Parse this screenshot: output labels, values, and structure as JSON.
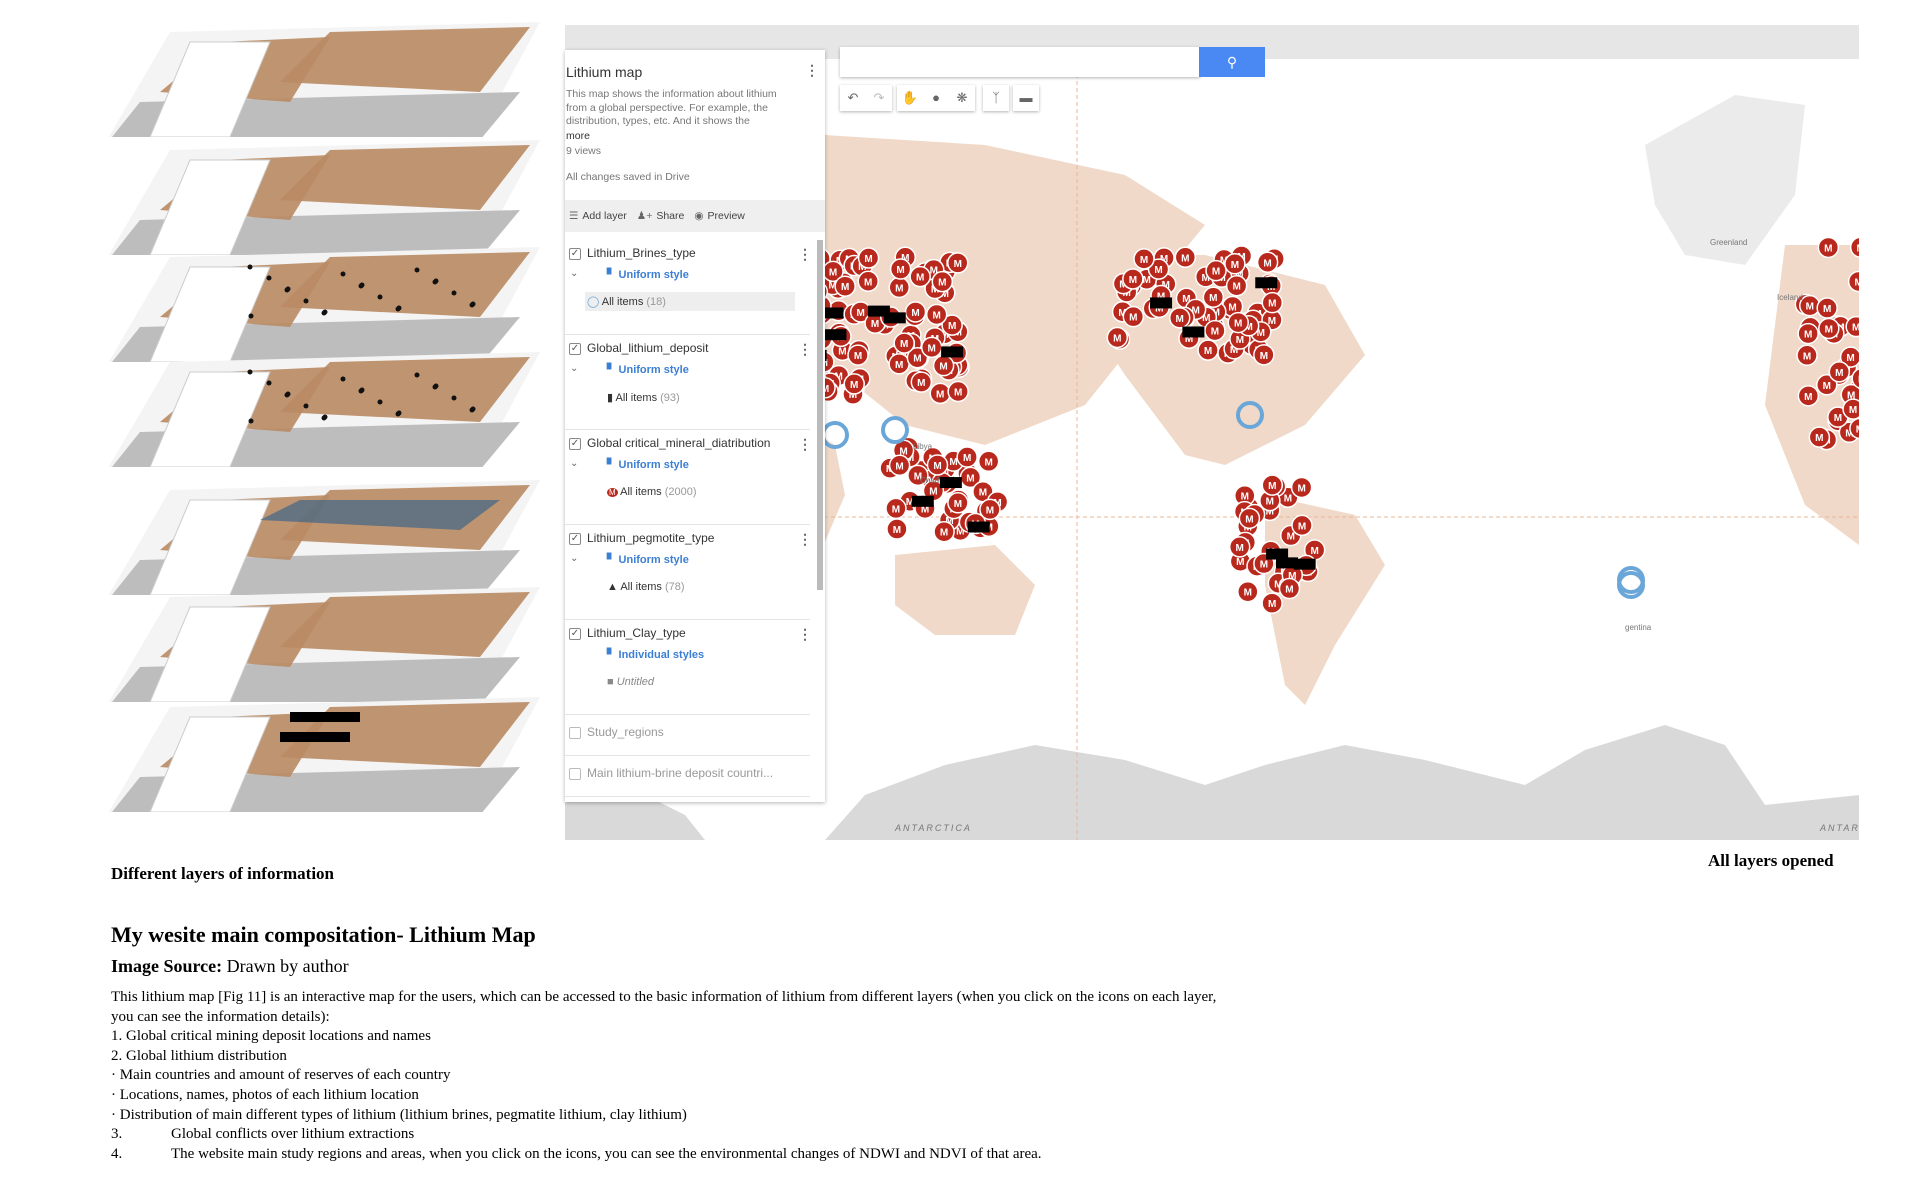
{
  "figure": {
    "left_caption": "Different layers of information",
    "right_caption": "All layers opened"
  },
  "map": {
    "title": "Lithium map",
    "description": "This map shows the information about lithium from a global perspective. For example, the distribution, types, etc. And it shows the",
    "more_label": "more",
    "views": "9 views",
    "saved_status": "All changes saved in Drive",
    "actions": {
      "add_layer": "Add layer",
      "share": "Share",
      "preview": "Preview"
    },
    "layers": [
      {
        "name": "Lithium_Brines_type",
        "checked": true,
        "style": "Uniform style",
        "items_label": "All items",
        "count": "(18)",
        "icon": "water-drop-icon"
      },
      {
        "name": "Global_lithium_deposit",
        "checked": true,
        "style": "Uniform style",
        "items_label": "All items",
        "count": "(93)",
        "icon": "battery-icon"
      },
      {
        "name": "Global critical_mineral_diatribution",
        "checked": true,
        "style": "Uniform style",
        "items_label": "All items",
        "count": "(2000)",
        "icon": "m-marker-icon"
      },
      {
        "name": "Lithium_pegmotite_type",
        "checked": true,
        "style": "Uniform style",
        "items_label": "All items",
        "count": "(78)",
        "icon": "mountain-icon"
      },
      {
        "name": "Lithium_Clay_type",
        "checked": true,
        "style": "Individual styles",
        "items_label": "Untitled",
        "count": "",
        "icon": "mine-cart-icon"
      },
      {
        "name": "Study_regions",
        "checked": false
      },
      {
        "name": "Main lithium-brine deposit countri...",
        "checked": false
      }
    ],
    "search": {
      "value": "",
      "placeholder": ""
    },
    "labels": {
      "antarctica": "ANTARCTICA",
      "antarctica2": "ANTARC",
      "greenland": "Greenland",
      "libya": "Libya",
      "chad": "Chad",
      "iceland": "Iceland",
      "argentina": "gentina"
    },
    "colors": {
      "marker": "#b8281c",
      "land": "#f0d9c8",
      "ice": "#d9d9d9",
      "accent": "#4a89f3",
      "brine": "#6aa7d8"
    }
  },
  "text": {
    "heading": "My wesite main compositation- Lithium Map",
    "source_label": "Image Source:",
    "source_value": " Drawn by author",
    "lines": [
      "This lithium map [Fig 11] is an interactive map for the users, which can be accessed to the basic information of lithium from different layers (when you click on the icons on each layer,",
      "you can see the information details):",
      "1. Global critical mining deposit locations and names",
      "2. Global lithium distribution",
      "· Main countries and amount of reserves of each country",
      "· Locations, names, photos of each lithium location",
      "· Distribution of main different types of lithium (lithium brines, pegmatite lithium, clay lithium)"
    ],
    "numbered": [
      {
        "num": "3.",
        "text": "Global conflicts over lithium extractions"
      },
      {
        "num": "4.",
        "text": "The website main study regions and areas, when you click on the icons, you can see the environmental changes of NDWI and NDVI of that area."
      }
    ]
  }
}
